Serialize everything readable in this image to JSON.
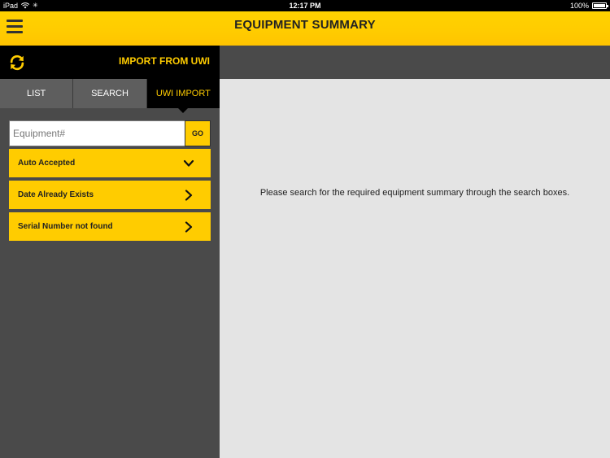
{
  "status_bar": {
    "device": "iPad",
    "time": "12:17 PM",
    "battery": "100%"
  },
  "header": {
    "title": "EQUIPMENT SUMMARY",
    "menu_icon": "hamburger-menu-icon"
  },
  "sidebar": {
    "title": "IMPORT FROM UWI",
    "refresh_icon": "refresh-icon",
    "tabs": [
      {
        "label": "LIST",
        "active": false
      },
      {
        "label": "SEARCH",
        "active": false
      },
      {
        "label": "UWI IMPORT",
        "active": true
      }
    ],
    "search": {
      "placeholder": "Equipment#",
      "value": "",
      "go_label": "GO"
    },
    "filters": [
      {
        "label": "Auto Accepted",
        "icon": "chevron-down-icon"
      },
      {
        "label": "Date Already Exists",
        "icon": "chevron-right-icon"
      },
      {
        "label": "Serial Number not found",
        "icon": "chevron-right-icon"
      }
    ]
  },
  "main": {
    "message": "Please search for the required equipment summary through the search boxes."
  },
  "colors": {
    "accent": "#ffcc00",
    "sidebar_bg": "#4a4a4a",
    "main_bg": "#e4e4e4"
  }
}
